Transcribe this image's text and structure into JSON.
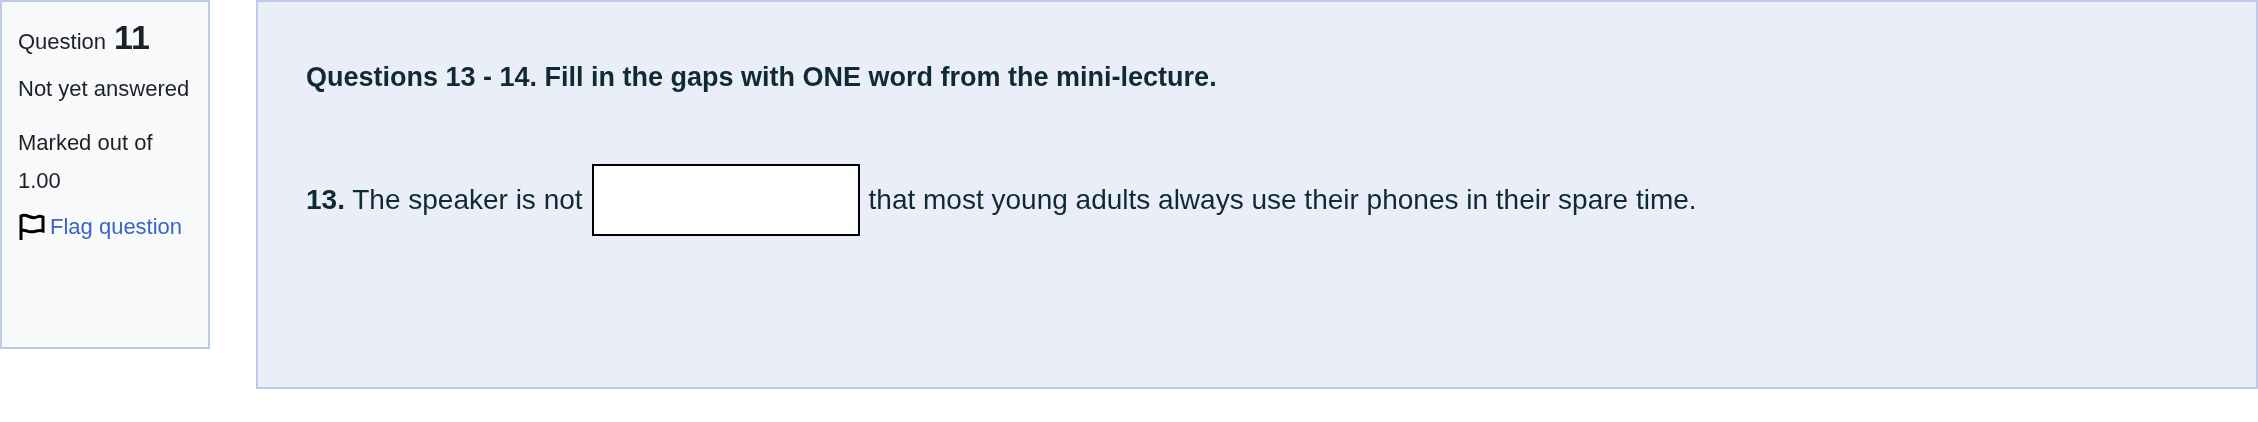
{
  "info": {
    "label": "Question",
    "number": "11",
    "status": "Not yet answered",
    "marks": "Marked out of 1.00",
    "flag": {
      "label": "Flag question",
      "flagged": false
    }
  },
  "content": {
    "heading": "Questions 13 - 14. Fill in the gaps with ONE word from the mini-lecture.",
    "question": {
      "number": "13.",
      "before": "The speaker is not",
      "after": "that most young adults always use their phones in their spare time."
    }
  }
}
